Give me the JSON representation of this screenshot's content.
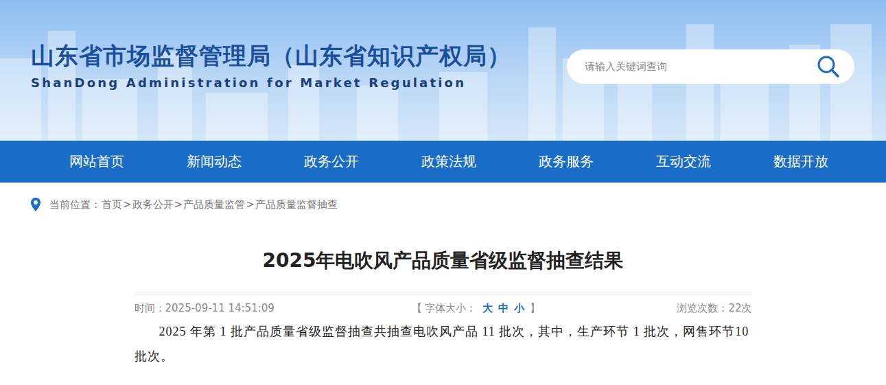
{
  "header": {
    "title": "山东省市场监督管理局（山东省知识产权局）",
    "subtitle": "ShanDong Administration for Market Regulation"
  },
  "search": {
    "placeholder": "请输入关键词查询"
  },
  "nav": {
    "items": [
      "网站首页",
      "新闻动态",
      "政务公开",
      "政策法规",
      "政务服务",
      "互动交流",
      "数据开放"
    ]
  },
  "breadcrumb": {
    "label": "当前位置：",
    "separator": ">",
    "items": [
      "首页",
      "政务公开",
      "产品质量监管",
      "产品质量监督抽查"
    ]
  },
  "article": {
    "title": "2025年电吹风产品质量省级监督抽查结果",
    "meta": {
      "time_label": "时间：",
      "time": "2025-09-11 14:51:09",
      "font_open": "【 字体大小：",
      "font_sizes": [
        "大",
        "中",
        "小"
      ],
      "font_close": "】",
      "views": "浏览次数：22次"
    },
    "paragraphs": [
      "2025 年第 1 批产品质量省级监督抽查共抽查电吹风产品 11 批次，其中，生产环节 1 批次，网售环节10批次。"
    ]
  }
}
